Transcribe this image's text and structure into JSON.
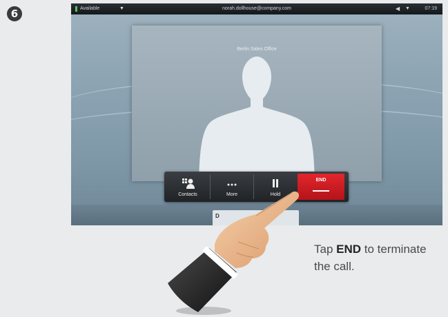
{
  "step": {
    "number": "6"
  },
  "status_bar": {
    "presence": "Available",
    "user": "norah.dollhouse@company.com",
    "time": "07:19"
  },
  "call": {
    "remote_name": "Berlin Sales Office"
  },
  "toolbar": {
    "contacts_label": "Contacts",
    "more_label": "More",
    "hold_label": "Hold",
    "end_label": "END"
  },
  "peek": {
    "label": "D"
  },
  "instruction": {
    "prefix": "Tap ",
    "keyword": "END",
    "suffix": " to terminate the call."
  },
  "colors": {
    "end_button": "#d71920",
    "toolbar": "#2b2e31",
    "presence_dot": "#59c25a"
  },
  "icons": [
    "contacts-icon",
    "more-icon",
    "pause-icon",
    "pointing-hand-icon"
  ]
}
